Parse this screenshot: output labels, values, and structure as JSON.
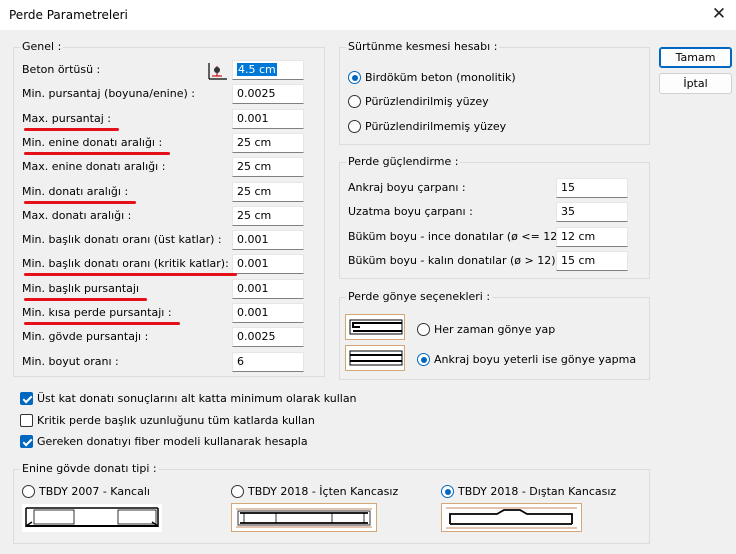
{
  "window": {
    "title": "Perde Parametreleri",
    "close_symbol": "✕"
  },
  "genel": {
    "legend": "Genel :",
    "rows": [
      {
        "label": "Beton örtüsü :",
        "value": "4.5 cm",
        "marked": false
      },
      {
        "label": "Min.  pursantaj (boyuna/enine) :",
        "value": "0.0025",
        "marked": false
      },
      {
        "label": "Max. pursantaj :",
        "value": "0.001",
        "marked": true
      },
      {
        "label": "Min. enine donatı aralığı :",
        "value": "25 cm",
        "marked": true
      },
      {
        "label": "Max. enine donatı aralığı :",
        "value": "25 cm",
        "marked": false
      },
      {
        "label": "Min. donatı aralığı :",
        "value": "25 cm",
        "marked": true
      },
      {
        "label": "Max. donatı aralığı :",
        "value": "25 cm",
        "marked": false
      },
      {
        "label": "Min. başlık donatı oranı (üst katlar) :",
        "value": "0.001",
        "marked": false
      },
      {
        "label": "Min. başlık donatı oranı (kritik katlar):",
        "value": "0.001",
        "marked": true
      },
      {
        "label": "Min. başlık pursantajı",
        "value": "0.001",
        "marked": true
      },
      {
        "label": "Min. kısa perde pursantajı :",
        "value": "0.001",
        "marked": true
      },
      {
        "label": "Min. gövde pursantajı :",
        "value": "0.0025",
        "marked": false
      },
      {
        "label": "Min. boyut oranı :",
        "value": "6",
        "marked": false
      }
    ]
  },
  "surtunme": {
    "legend": "Sürtünme kesmesi hesabı :",
    "options": [
      {
        "label": "Birdöküm beton (monolitik)",
        "selected": true
      },
      {
        "label": "Pürüzlendirilmiş yüzey",
        "selected": false
      },
      {
        "label": "Pürüzlendirilmemiş yüzey",
        "selected": false
      }
    ]
  },
  "guclendirme": {
    "legend": "Perde güçlendirme :",
    "rows": [
      {
        "label": "Ankraj boyu çarpanı :",
        "value": "15"
      },
      {
        "label": "Uzatma boyu çarpanı :",
        "value": "35"
      },
      {
        "label": "Büküm boyu - ince donatılar (ø <= 12) :",
        "value": "12 cm"
      },
      {
        "label": "Büküm boyu - kalın donatılar (ø > 12) :",
        "value": "15 cm"
      }
    ]
  },
  "gonye": {
    "legend": "Perde gönye seçenekleri :",
    "options": [
      {
        "label": "Her zaman gönye yap",
        "selected": false
      },
      {
        "label": "Ankraj boyu yeterli ise gönye yapma",
        "selected": true
      }
    ]
  },
  "checkboxes": [
    {
      "label": "Üst kat donatı sonuçlarını alt katta minimum olarak kullan",
      "checked": true
    },
    {
      "label": "Kritik perde başlık uzunluğunu tüm katlarda kullan",
      "checked": false
    },
    {
      "label": "Gereken donatıyı fiber modeli kullanarak hesapla",
      "checked": true
    }
  ],
  "enine": {
    "legend": "Enine gövde donatı tipi :",
    "options": [
      {
        "label": "TBDY 2007 - Kancalı",
        "selected": false
      },
      {
        "label": "TBDY 2018 - İçten Kancasız",
        "selected": false
      },
      {
        "label": "TBDY 2018 - Dıştan Kancasız",
        "selected": true
      }
    ]
  },
  "buttons": {
    "ok": "Tamam",
    "cancel": "İptal"
  },
  "colors": {
    "accent": "#0067c0",
    "selection": "#0078d7",
    "annotation": "#e4101a"
  }
}
